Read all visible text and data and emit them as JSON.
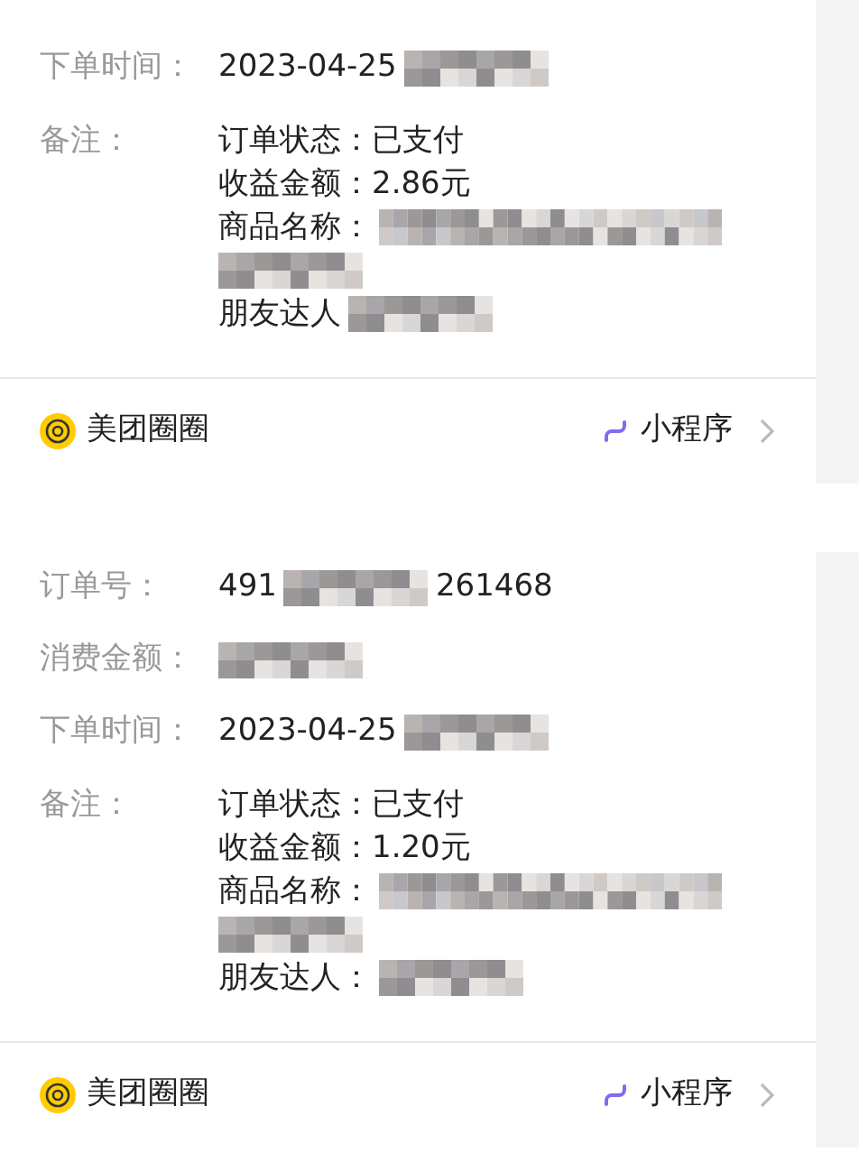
{
  "cards": [
    {
      "rows": [
        {
          "label": "下单时间：",
          "value": [
            {
              "kind": "text",
              "text": "2023-04-25"
            },
            {
              "kind": "blur"
            }
          ]
        }
      ],
      "note": {
        "label": "备注：",
        "lines": [
          [
            {
              "kind": "text",
              "text": "订单状态：已支付"
            }
          ],
          [
            {
              "kind": "text",
              "text": "收益金额：2.86元"
            }
          ],
          [
            {
              "kind": "text",
              "text": "商品名称："
            },
            {
              "kind": "blur_long"
            }
          ],
          [
            {
              "kind": "blur"
            }
          ],
          [
            {
              "kind": "text",
              "text": "朋友达人"
            },
            {
              "kind": "blur"
            }
          ]
        ]
      },
      "footer": {
        "source": "美团圈圈",
        "link": "小程序"
      }
    },
    {
      "rows": [
        {
          "label": "订单号：",
          "value": [
            {
              "kind": "text",
              "text": "491"
            },
            {
              "kind": "blur"
            },
            {
              "kind": "text",
              "text": "261468"
            }
          ]
        },
        {
          "label": "消费金额：",
          "value": [
            {
              "kind": "blur"
            }
          ]
        },
        {
          "label": "下单时间：",
          "value": [
            {
              "kind": "text",
              "text": "2023-04-25"
            },
            {
              "kind": "blur"
            }
          ]
        }
      ],
      "note": {
        "label": "备注：",
        "lines": [
          [
            {
              "kind": "text",
              "text": "订单状态：已支付"
            }
          ],
          [
            {
              "kind": "text",
              "text": "收益金额：1.20元"
            }
          ],
          [
            {
              "kind": "text",
              "text": "商品名称："
            },
            {
              "kind": "blur_long"
            }
          ],
          [
            {
              "kind": "blur"
            }
          ],
          [
            {
              "kind": "text",
              "text": "朋友达人："
            },
            {
              "kind": "blur"
            }
          ]
        ]
      },
      "footer": {
        "source": "美团圈圈",
        "link": "小程序"
      }
    }
  ]
}
